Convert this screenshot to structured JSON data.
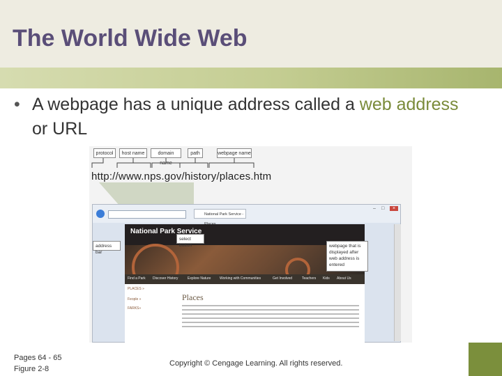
{
  "slide": {
    "title": "The World Wide Web",
    "bullet_before": "A webpage has a unique address called a ",
    "bullet_highlight": "web address",
    "bullet_after": " or URL",
    "footer_pages": "Pages 64 - 65",
    "footer_figure": "Figure 2-8",
    "copyright": "Copyright © Cengage Learning. All rights reserved."
  },
  "figure": {
    "url_parts": [
      "protocol",
      "host name",
      "domain name",
      "path",
      "webpage name"
    ],
    "url": "http://www.nps.gov/history/places.htm",
    "tab_label": "National Park Service - Places...",
    "site_title": "National Park Service",
    "nav_items": [
      "Find a Park",
      "Discover History",
      "Explore Nature",
      "Working with Communities",
      "Get Involved",
      "Teachers",
      "Kids",
      "About Us"
    ],
    "side_nav": [
      "PLACES »",
      "Feople »",
      "FARKS»"
    ],
    "places_heading": "Places",
    "callout_address_bar": "address bar",
    "callout_select_button": "select button",
    "callout_webpage": "webpage that is displayed after web address is entered"
  },
  "colors": {
    "title": "#5a4e78",
    "highlight": "#7a8b3a",
    "accent": "#7b8f3c"
  }
}
